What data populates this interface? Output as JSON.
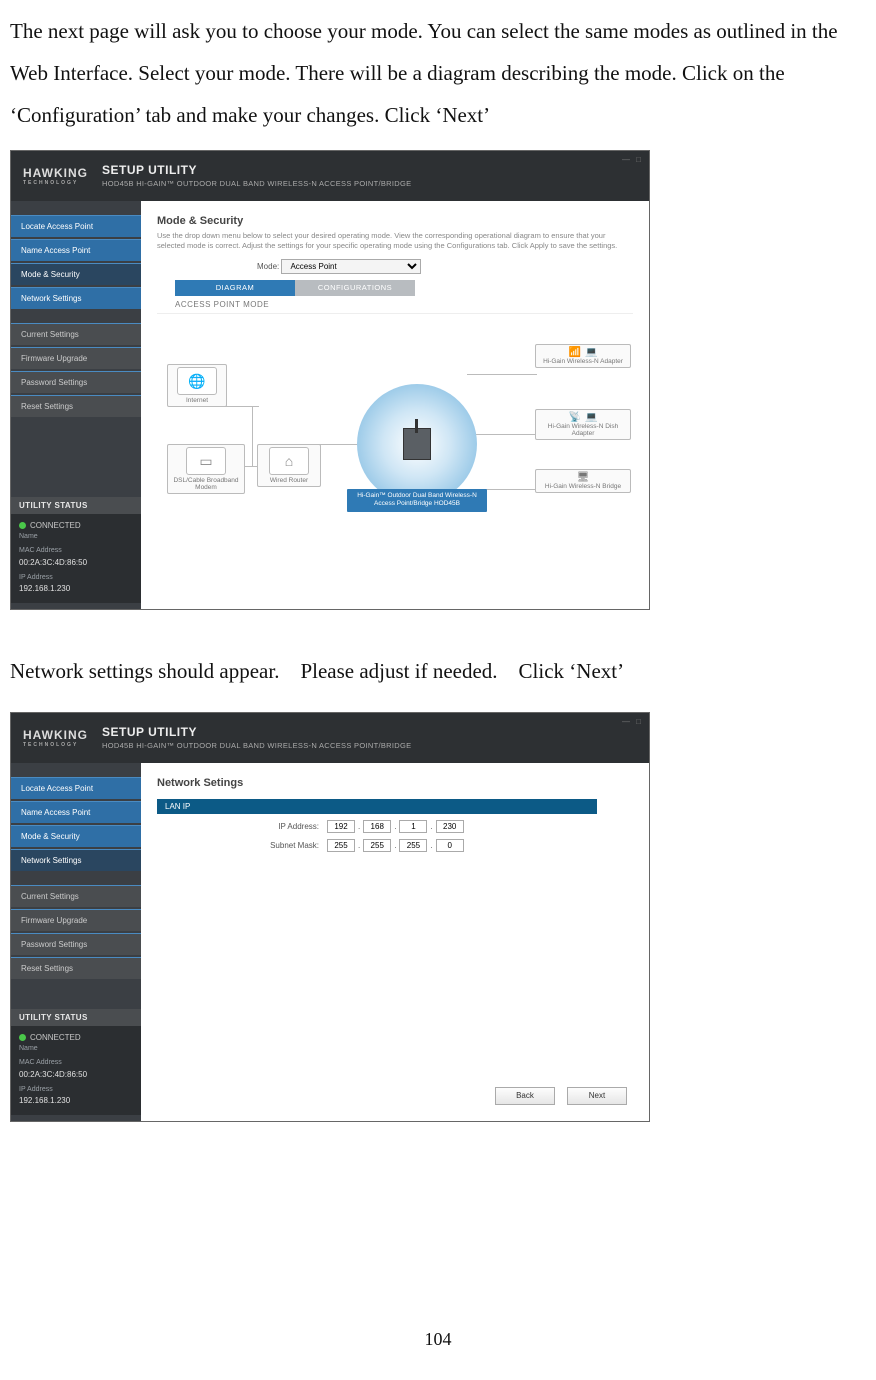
{
  "page": {
    "intro1": "The next page will ask you to choose your mode. You can select the same modes as outlined in the Web Interface. Select your mode. There will be a diagram describing the mode. Click on the ‘Configuration’ tab and make your changes. Click ‘Next’",
    "intro2": "Network settings should appear. Please adjust if needed. Click ‘Next’",
    "pageNumber": "104"
  },
  "app": {
    "brand": "HAWKING",
    "brandSub": "TECHNOLOGY",
    "title": "SETUP UTILITY",
    "subtitle": "HOD45B HI-GAIN™ OUTDOOR DUAL BAND WIRELESS-N ACCESS POINT/BRIDGE"
  },
  "sidebar": {
    "group1": [
      {
        "label": "Locate Access Point"
      },
      {
        "label": "Name Access Point"
      },
      {
        "label": "Mode & Security"
      },
      {
        "label": "Network Settings"
      }
    ],
    "group2": [
      {
        "label": "Current Settings"
      },
      {
        "label": "Firmware Upgrade"
      },
      {
        "label": "Password Settings"
      },
      {
        "label": "Reset Settings"
      }
    ],
    "utilHeader": "UTILITY STATUS",
    "status": "CONNECTED",
    "nameLabel": "Name",
    "nameValue": "",
    "macLabel": "MAC Address",
    "macValue": "00:2A:3C:4D:86:50",
    "ipLabel": "IP Address",
    "ipValue": "192.168.1.230"
  },
  "modePane": {
    "heading": "Mode & Security",
    "desc": "Use the drop down menu below to select your desired operating mode.  View the corresponding operational diagram to ensure that your selected mode is correct.  Adjust the settings for your specific operating mode using the Configurations tab.  Click Apply to save the settings.",
    "modeLabel": "Mode:",
    "modeValue": "Access Point",
    "tabDiagram": "DIAGRAM",
    "tabConfig": "CONFIGURATIONS",
    "apMode": "ACCESS POINT MODE",
    "diagram": {
      "internet": "Internet",
      "modem": "DSL/Cable Broadband Modem",
      "router": "Wired Router",
      "centerLabel": "Hi-Gain™ Outdoor Dual Band Wireless-N Access Point/Bridge HOD45B",
      "adapter": "Hi-Gain Wireless-N Adapter",
      "dish": "Hi-Gain Wireless-N Dish Adapter",
      "bridge": "Hi-Gain Wireless-N Bridge"
    }
  },
  "netPane": {
    "heading": "Network Setings",
    "lanip": "LAN IP",
    "ipLabel": "IP Address:",
    "maskLabel": "Subnet Mask:",
    "ip": [
      "192",
      "168",
      "1",
      "230"
    ],
    "mask": [
      "255",
      "255",
      "255",
      "0"
    ],
    "back": "Back",
    "next": "Next"
  }
}
